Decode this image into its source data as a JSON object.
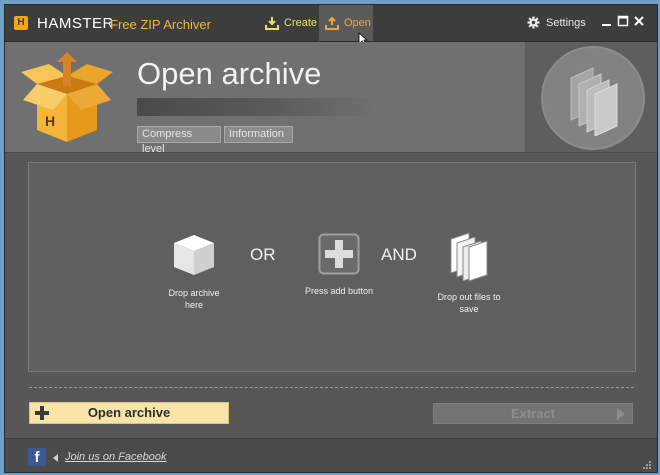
{
  "titlebar": {
    "logo_letter": "H",
    "brand_name": "HAMSTER",
    "brand_subtitle": "Free ZIP Archiver",
    "tabs": [
      {
        "label": "Create",
        "icon": "download-tray-icon",
        "active": false
      },
      {
        "label": "Open",
        "icon": "upload-tray-icon",
        "active": true
      }
    ],
    "settings_label": "Settings"
  },
  "header": {
    "title": "Open archive",
    "buttons": {
      "compress_level": "Compress level",
      "information": "Information"
    }
  },
  "dropzone": {
    "items": [
      {
        "label": "Drop archive here",
        "icon": "package-box-icon"
      },
      {
        "label": "Press add button",
        "icon": "plus-square-icon"
      },
      {
        "label": "Drop out files to save",
        "icon": "files-stack-icon"
      }
    ],
    "or_label": "OR",
    "and_label": "AND"
  },
  "actions": {
    "open_archive": "Open archive",
    "extract": "Extract",
    "extract_enabled": false
  },
  "footer": {
    "facebook_link": "Join us on Facebook",
    "facebook_glyph": "f"
  },
  "colors": {
    "window_bg": "#575757",
    "titlebar_bg": "#3d3d3d",
    "accent_orange": "#f4a51c",
    "create_yellow": "#e9e16e",
    "open_button_bg": "#f7e4a6"
  }
}
